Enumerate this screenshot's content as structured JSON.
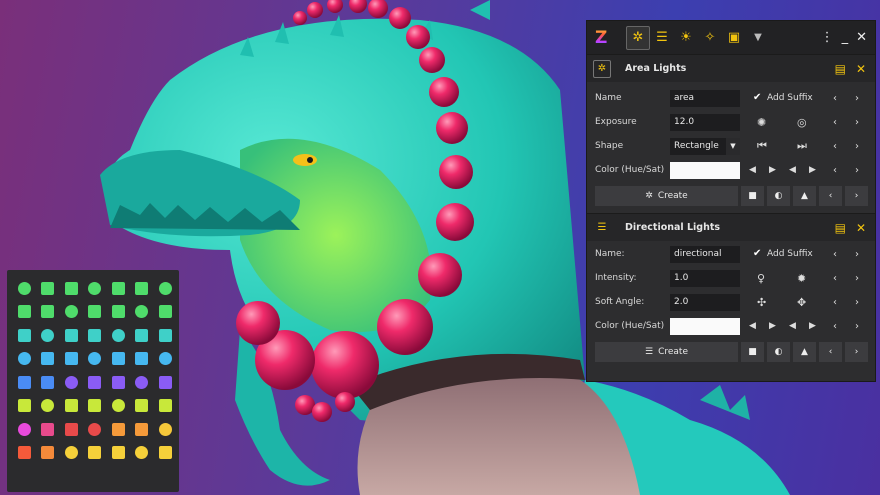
{
  "app": {
    "logo": "Z"
  },
  "colors": {
    "accent": "#f2c40f",
    "panel": "#2d2d2f",
    "field": "#1d1d1f"
  },
  "toolbar": {
    "icons": [
      "area-light-icon",
      "directional-light-icon",
      "sun-icon",
      "bulb-icon",
      "spotlight-icon",
      "dropdown-icon"
    ],
    "right": [
      "more-icon",
      "minimize-icon",
      "close-icon"
    ]
  },
  "area_lights": {
    "title": "Area Lights",
    "name_label": "Name",
    "name_value": "area",
    "add_suffix_label": "Add Suffix",
    "exposure_label": "Exposure",
    "exposure_value": "12.0",
    "shape_label": "Shape",
    "shape_value": "Rectangle",
    "color_label": "Color (Hue/Sat)",
    "create_label": "Create"
  },
  "directional_lights": {
    "title": "Directional Lights",
    "name_label": "Name:",
    "name_value": "directional",
    "add_suffix_label": "Add Suffix",
    "intensity_label": "Intensity:",
    "intensity_value": "1.0",
    "soft_angle_label": "Soft Angle:",
    "soft_angle_value": "2.0",
    "color_label": "Color (Hue/Sat)",
    "create_label": "Create"
  },
  "palette": {
    "colors": [
      "#4fdc6b",
      "#4fdc6b",
      "#4fdc6b",
      "#4fdc6b",
      "#4fdc6b",
      "#4fdc6b",
      "#4fdc6b",
      "#4fdc6b",
      "#4fdc6b",
      "#4fdc6b",
      "#4fdc6b",
      "#4fdc6b",
      "#4fdc6b",
      "#4fdc6b",
      "#3fd0c8",
      "#3fd0c8",
      "#3fd0c8",
      "#3fd0c8",
      "#3fd0c8",
      "#3fd0c8",
      "#3fd0c8",
      "#46b8f0",
      "#46b8f0",
      "#46b8f0",
      "#46b8f0",
      "#46b8f0",
      "#46b8f0",
      "#46b8f0",
      "#4a8cf5",
      "#4a8cf5",
      "#8a5cf5",
      "#8a5cf5",
      "#8a5cf5",
      "#8a5cf5",
      "#8a5cf5",
      "#c8e83a",
      "#c8e83a",
      "#c8e83a",
      "#c8e83a",
      "#c8e83a",
      "#c8e83a",
      "#c8e83a",
      "#e84adc",
      "#e84a8c",
      "#e84a4a",
      "#e84a4a",
      "#f59a3a",
      "#f59a3a",
      "#f5c83a",
      "#f55a3a",
      "#f58a3a",
      "#f5d03a",
      "#f5d03a",
      "#f5d03a",
      "#f5d03a",
      "#f5d03a"
    ]
  }
}
